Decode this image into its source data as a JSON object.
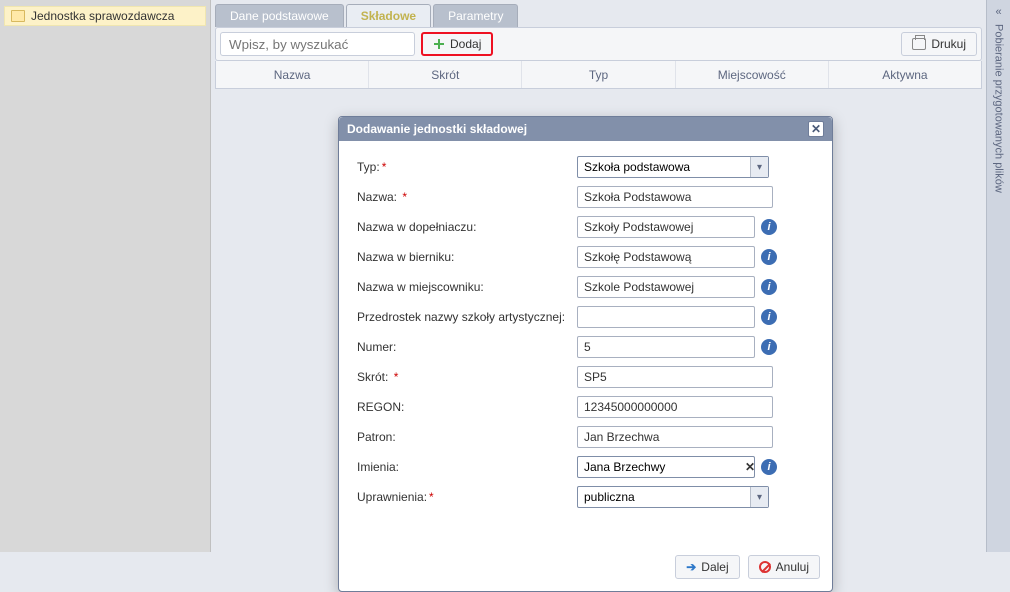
{
  "sidebar": {
    "root": "Jednostka sprawozdawcza"
  },
  "tabs": [
    {
      "label": "Dane podstawowe",
      "active": false
    },
    {
      "label": "Składowe",
      "active": true
    },
    {
      "label": "Parametry",
      "active": false
    }
  ],
  "toolbar": {
    "search_placeholder": "Wpisz, by wyszukać",
    "add_label": "Dodaj",
    "print_label": "Drukuj"
  },
  "columns": [
    "Nazwa",
    "Skrót",
    "Typ",
    "Miejscowość",
    "Aktywna"
  ],
  "rail": {
    "label": "Pobieranie przygotowanych plików"
  },
  "modal": {
    "title": "Dodawanie jednostki składowej",
    "fields": {
      "typ": {
        "label": "Typ:",
        "value": "Szkoła podstawowa",
        "required": true
      },
      "nazwa": {
        "label": "Nazwa:",
        "value": "Szkoła Podstawowa",
        "required": true
      },
      "dopel": {
        "label": "Nazwa w dopełniaczu:",
        "value": "Szkoły Podstawowej"
      },
      "biernik": {
        "label": "Nazwa w bierniku:",
        "value": "Szkołę Podstawową"
      },
      "miejsc": {
        "label": "Nazwa w miejscowniku:",
        "value": "Szkole Podstawowej"
      },
      "przedrostek": {
        "label": "Przedrostek nazwy szkoły artystycznej:",
        "value": ""
      },
      "numer": {
        "label": "Numer:",
        "value": "5"
      },
      "skrot": {
        "label": "Skrót:",
        "value": "SP5",
        "required": true
      },
      "regon": {
        "label": "REGON:",
        "value": "12345000000000"
      },
      "patron": {
        "label": "Patron:",
        "value": "Jan Brzechwa"
      },
      "imienia": {
        "label": "Imienia:",
        "value": "Jana Brzechwy"
      },
      "upraw": {
        "label": "Uprawnienia:",
        "value": "publiczna",
        "required": true
      }
    },
    "buttons": {
      "next": "Dalej",
      "cancel": "Anuluj"
    }
  }
}
